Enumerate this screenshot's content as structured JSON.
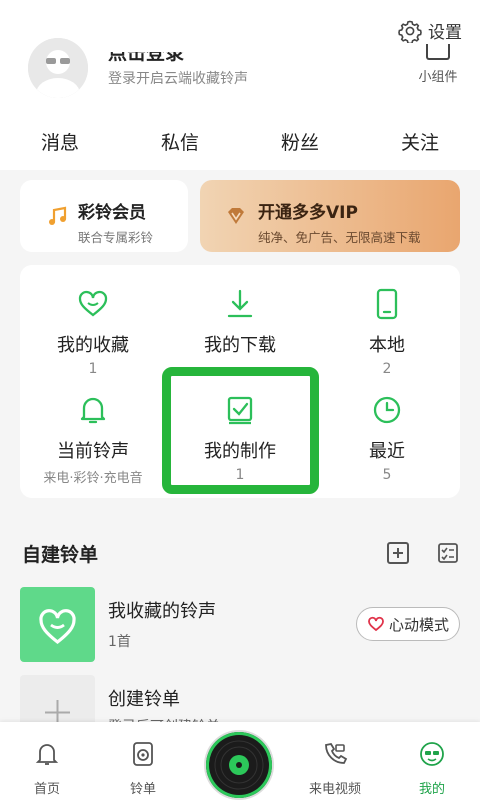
{
  "header": {
    "settings_label": "设置",
    "login_title": "点击登录",
    "login_sub": "登录开启云端收藏铃声",
    "widget_label": "小组件"
  },
  "stats": [
    "消息",
    "私信",
    "粉丝",
    "关注"
  ],
  "vip": {
    "member_title": "彩铃会员",
    "member_sub": "联合专属彩铃",
    "vip_title": "开通多多VIP",
    "vip_sub": "纯净、免广告、无限高速下载"
  },
  "grid": [
    {
      "label": "我的收藏",
      "count": "1",
      "icon": "heart-icon"
    },
    {
      "label": "我的下载",
      "count": "",
      "icon": "download-icon"
    },
    {
      "label": "本地",
      "count": "2",
      "icon": "phone-icon"
    },
    {
      "label": "当前铃声",
      "count": "来电·彩铃·充电音",
      "icon": "bell-icon"
    },
    {
      "label": "我的制作",
      "count": "1",
      "icon": "make-icon"
    },
    {
      "label": "最近",
      "count": "5",
      "icon": "clock-icon"
    }
  ],
  "section": {
    "title": "自建铃单"
  },
  "list": [
    {
      "title": "我收藏的铃声",
      "sub": "1首"
    },
    {
      "title": "创建铃单",
      "sub": "登录后可创建铃单"
    }
  ],
  "heart_mode_label": "心动模式",
  "tabs": [
    {
      "label": "首页"
    },
    {
      "label": "铃单"
    },
    {
      "label": "来电视频"
    },
    {
      "label": "我的"
    }
  ],
  "colors": {
    "accent": "#1fa34a",
    "highlight": "#26b53b",
    "heart_thumb": "#5fd98a",
    "vip_gradient_start": "#f1d4b3",
    "vip_gradient_end": "#e9a66f"
  }
}
